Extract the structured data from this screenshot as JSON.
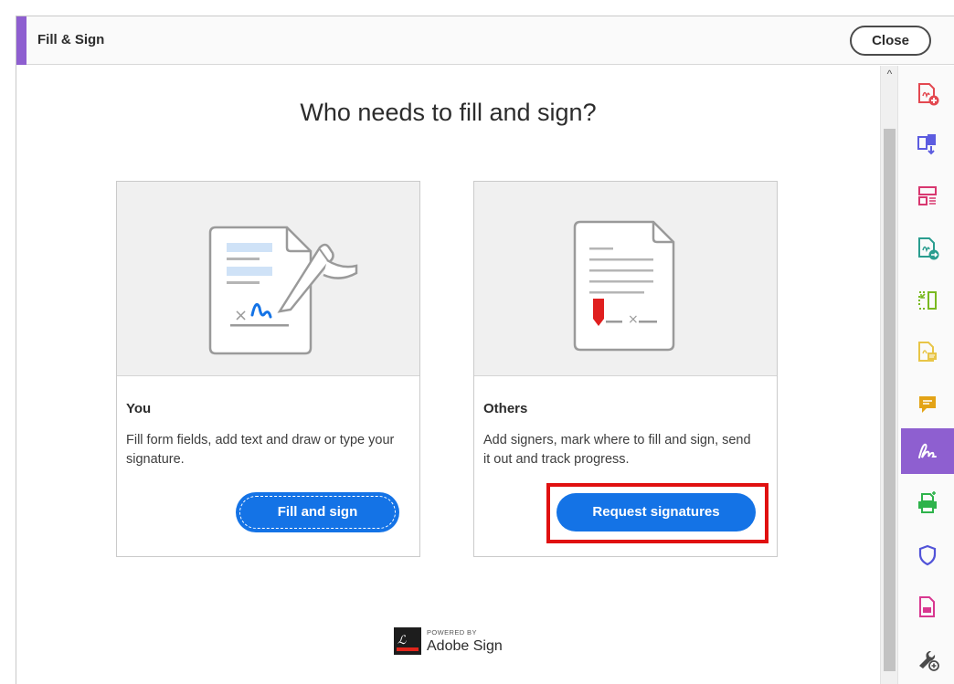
{
  "panel": {
    "title": "Fill & Sign",
    "close_label": "Close",
    "accent_color": "#8e5fd0"
  },
  "main": {
    "heading": "Who needs to fill and sign?"
  },
  "cards": {
    "you": {
      "title": "You",
      "description": "Fill form fields, add text and draw or type your signature.",
      "button_label": "Fill and sign",
      "illustration_icon": "document-signing-hand-icon"
    },
    "others": {
      "title": "Others",
      "description": "Add signers, mark where to fill and sign, send it out and track progress.",
      "button_label": "Request signatures",
      "illustration_icon": "document-signature-field-icon",
      "highlighted": true,
      "highlight_color": "#e01010"
    }
  },
  "branding": {
    "powered_by": "POWERED BY",
    "product": "Adobe Sign"
  },
  "button_color": "#1473e6",
  "right_toolbar": {
    "tools": [
      {
        "icon": "create-pdf-icon",
        "color": "#e34850"
      },
      {
        "icon": "combine-files-icon",
        "color": "#5c5ce0"
      },
      {
        "icon": "organize-pages-icon",
        "color": "#d8376f"
      },
      {
        "icon": "export-pdf-icon",
        "color": "#2a9d8f"
      },
      {
        "icon": "edit-pdf-icon",
        "color": "#79b920"
      },
      {
        "icon": "comment-file-icon",
        "color": "#e8c547"
      },
      {
        "icon": "comment-icon",
        "color": "#e3a316"
      },
      {
        "icon": "fill-sign-icon",
        "color": "#ffffff",
        "active": true
      },
      {
        "icon": "print-production-icon",
        "color": "#2eb34b"
      },
      {
        "icon": "protect-icon",
        "color": "#5153d8"
      },
      {
        "icon": "document-icon",
        "color": "#d83790"
      },
      {
        "icon": "more-tools-icon",
        "color": "#4b4b4b"
      }
    ]
  }
}
